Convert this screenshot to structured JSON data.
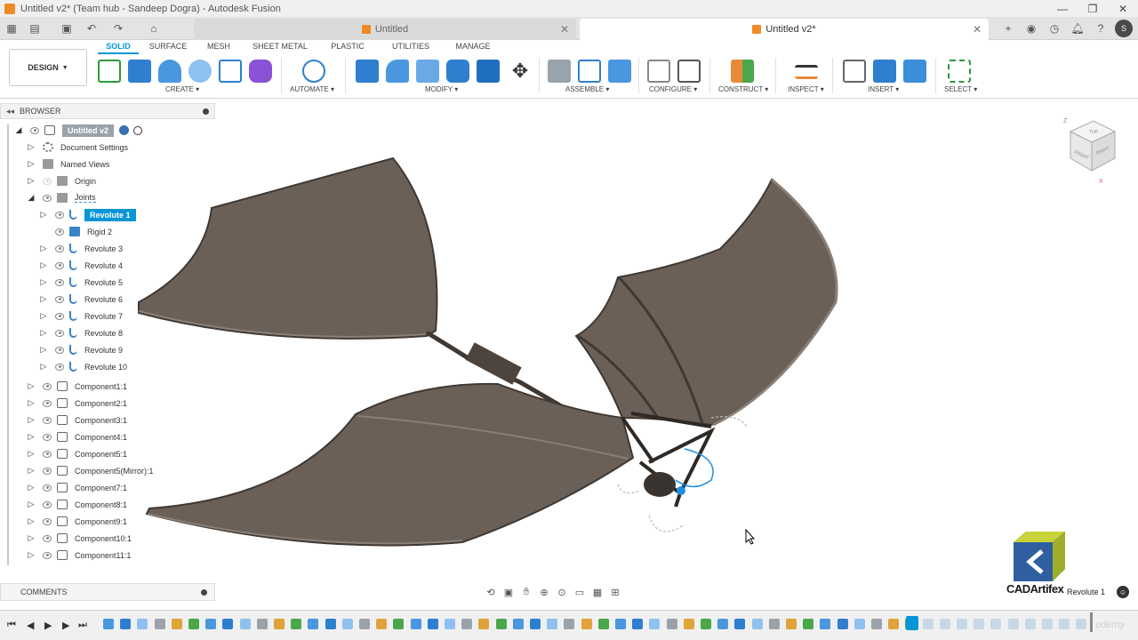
{
  "window": {
    "title": "Untitled v2* (Team hub - Sandeep Dogra) - Autodesk Fusion"
  },
  "tabs": [
    {
      "label": "Untitled",
      "active": false
    },
    {
      "label": "Untitled v2*",
      "active": true
    }
  ],
  "ribbon": {
    "workspace": "DESIGN",
    "tabs": [
      "SOLID",
      "SURFACE",
      "MESH",
      "SHEET METAL",
      "PLASTIC",
      "UTILITIES",
      "MANAGE"
    ],
    "active_tab": "SOLID",
    "groups": [
      "CREATE",
      "AUTOMATE",
      "MODIFY",
      "ASSEMBLE",
      "CONFIGURE",
      "CONSTRUCT",
      "INSPECT",
      "INSERT",
      "SELECT"
    ]
  },
  "browser": {
    "title": "BROWSER",
    "root": "Untitled v2",
    "items": [
      {
        "label": "Document Settings",
        "icon": "gear-icon"
      },
      {
        "label": "Named Views",
        "icon": "folder-icon"
      },
      {
        "label": "Origin",
        "icon": "folder-icon"
      },
      {
        "label": "Joints",
        "icon": "folder-icon"
      },
      {
        "label": "Revolute 1",
        "icon": "joint-icon",
        "selected": true
      },
      {
        "label": "Rigid 2",
        "icon": "rigid-joint-icon"
      },
      {
        "label": "Revolute 3",
        "icon": "joint-icon"
      },
      {
        "label": "Revolute 4",
        "icon": "joint-icon"
      },
      {
        "label": "Revolute 5",
        "icon": "joint-icon"
      },
      {
        "label": "Revolute 6",
        "icon": "joint-icon"
      },
      {
        "label": "Revolute 7",
        "icon": "joint-icon"
      },
      {
        "label": "Revolute 8",
        "icon": "joint-icon"
      },
      {
        "label": "Revolute 9",
        "icon": "joint-icon"
      },
      {
        "label": "Revolute 10",
        "icon": "joint-icon"
      },
      {
        "label": "Component1:1",
        "icon": "component-icon"
      },
      {
        "label": "Component2:1",
        "icon": "component-icon"
      },
      {
        "label": "Component3:1",
        "icon": "component-icon"
      },
      {
        "label": "Component4:1",
        "icon": "component-icon"
      },
      {
        "label": "Component5:1",
        "icon": "component-icon"
      },
      {
        "label": "Component5(Mirror):1",
        "icon": "component-icon"
      },
      {
        "label": "Component7:1",
        "icon": "component-icon"
      },
      {
        "label": "Component8:1",
        "icon": "component-icon"
      },
      {
        "label": "Component9:1",
        "icon": "component-icon"
      },
      {
        "label": "Component10:1",
        "icon": "component-icon"
      },
      {
        "label": "Component11:1",
        "icon": "component-icon"
      }
    ]
  },
  "comments": {
    "title": "COMMENTS"
  },
  "viewcube": {
    "top": "TOP",
    "front": "FRONT",
    "right": "RIGHT",
    "axis_x": "X",
    "axis_z": "Z"
  },
  "branding": {
    "logo_text": "CADArtifex",
    "watermark": "udemy"
  },
  "status": {
    "selection": "Revolute 1"
  },
  "colors": {
    "accent": "#0696d7",
    "wing": "#6b6058",
    "wing_edge": "#4d443d"
  }
}
